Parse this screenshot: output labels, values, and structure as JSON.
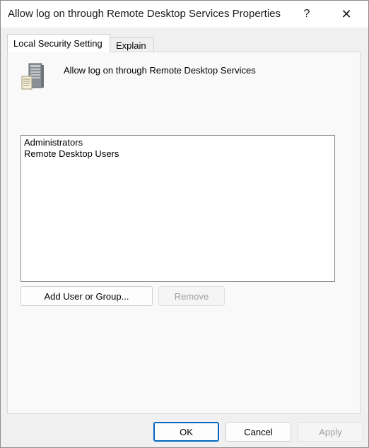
{
  "window": {
    "title": "Allow log on through Remote Desktop Services Properties",
    "help_glyph": "?",
    "close_glyph": "✕"
  },
  "tabs": [
    {
      "label": "Local Security Setting",
      "active": true
    },
    {
      "label": "Explain",
      "active": false
    }
  ],
  "policy": {
    "icon": "server-policy-icon",
    "name": "Allow log on through Remote Desktop Services"
  },
  "members": [
    "Administrators",
    "Remote Desktop Users"
  ],
  "buttons": {
    "add": "Add User or Group...",
    "remove": "Remove",
    "ok": "OK",
    "cancel": "Cancel",
    "apply": "Apply"
  },
  "colors": {
    "accent": "#0067c0"
  }
}
